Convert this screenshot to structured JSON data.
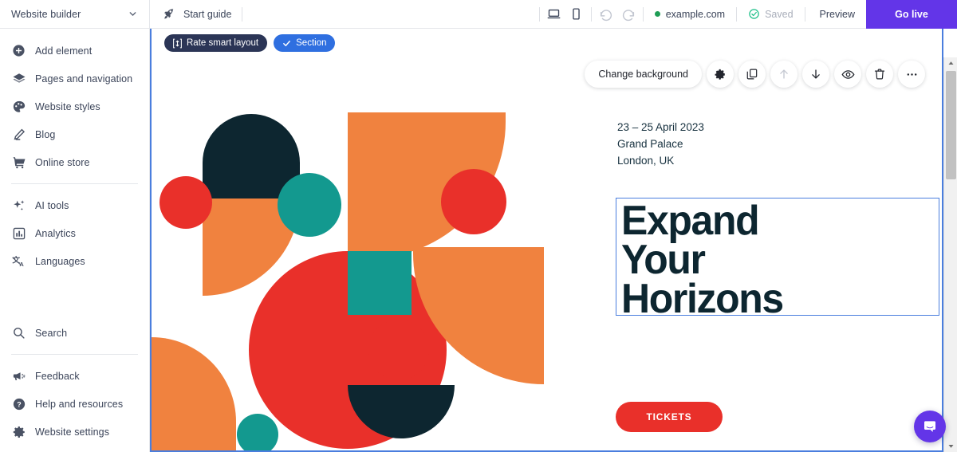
{
  "sidebar": {
    "header": {
      "title": "Website builder",
      "chevron_icon": "chevron-down-icon"
    },
    "items_main": [
      {
        "label": "Add element",
        "icon": "plus-circle-icon"
      },
      {
        "label": "Pages and navigation",
        "icon": "layers-icon"
      },
      {
        "label": "Website styles",
        "icon": "palette-icon"
      },
      {
        "label": "Blog",
        "icon": "pencil-icon"
      },
      {
        "label": "Online store",
        "icon": "shopping-cart-icon"
      }
    ],
    "items_tools": [
      {
        "label": "AI tools",
        "icon": "sparkles-icon"
      },
      {
        "label": "Analytics",
        "icon": "bar-chart-icon"
      },
      {
        "label": "Languages",
        "icon": "translate-icon"
      }
    ],
    "items_bottom_top": [
      {
        "label": "Search",
        "icon": "search-icon"
      }
    ],
    "items_bottom": [
      {
        "label": "Feedback",
        "icon": "megaphone-icon"
      },
      {
        "label": "Help and resources",
        "icon": "question-circle-icon"
      },
      {
        "label": "Website settings",
        "icon": "gear-icon"
      }
    ]
  },
  "topbar": {
    "start_guide": {
      "label": "Start guide",
      "icon": "rocket-icon"
    },
    "desktop_icon": "desktop-icon",
    "mobile_icon": "mobile-icon",
    "undo_icon": "undo-icon",
    "redo_icon": "redo-icon",
    "domain": {
      "label": "example.com",
      "status_color": "#1f9d55"
    },
    "saved": {
      "label": "Saved",
      "icon": "check-circle-icon",
      "color": "#1fc08a"
    },
    "preview": {
      "label": "Preview"
    },
    "go_live": {
      "label": "Go live",
      "color": "#6335e8"
    }
  },
  "canvas": {
    "chips": [
      {
        "label": "Rate smart layout",
        "icon": "height-resize-icon",
        "style": "dark"
      },
      {
        "label": "Section",
        "icon": "check-icon",
        "style": "blue"
      }
    ],
    "toolbar": {
      "change_background": "Change background",
      "buttons": [
        {
          "icon": "gear-icon",
          "disabled": false
        },
        {
          "icon": "duplicate-icon",
          "disabled": false
        },
        {
          "icon": "arrow-up-icon",
          "disabled": true
        },
        {
          "icon": "arrow-down-icon",
          "disabled": false
        },
        {
          "icon": "eye-icon",
          "disabled": false
        },
        {
          "icon": "trash-icon",
          "disabled": false
        },
        {
          "icon": "ellipsis-icon",
          "disabled": false
        }
      ]
    },
    "selection_border_color": "#4a7ede"
  },
  "hero": {
    "meta": {
      "dates": "23 – 25 April 2023",
      "venue": "Grand Palace",
      "location": "London, UK"
    },
    "headline_lines": [
      "Expand",
      "Your",
      "Horizons"
    ],
    "cta": {
      "label": "TICKETS",
      "color": "#e9302a"
    },
    "palette": {
      "orange": "#f0823f",
      "red": "#e9302a",
      "teal": "#13998f",
      "navy": "#0d2630",
      "white": "#ffffff"
    }
  },
  "scrollbar": {
    "up_icon": "caret-up-icon",
    "down_icon": "caret-down-icon"
  },
  "chat_widget": {
    "icon": "chat-bubble-icon",
    "color": "#6335e8"
  }
}
